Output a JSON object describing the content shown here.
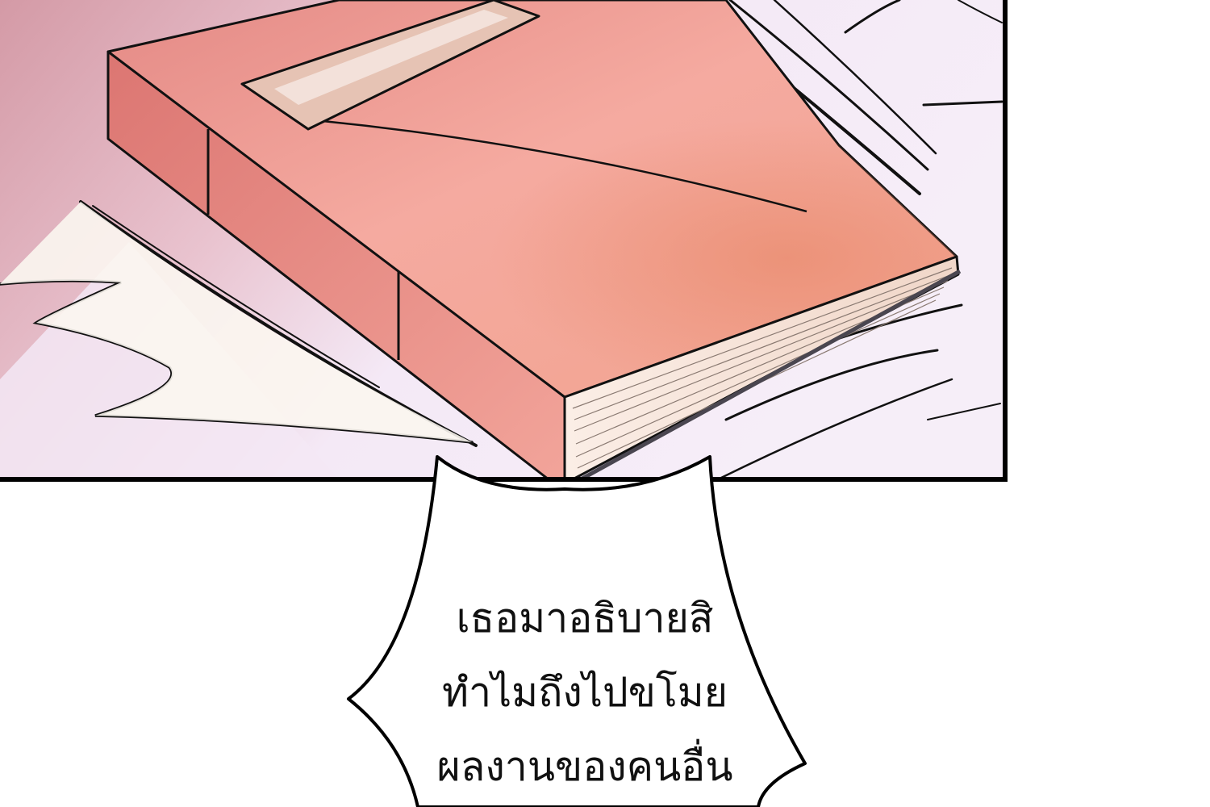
{
  "panel": {
    "background_color": "#f2e7f5",
    "shadow_color": "#d49aa6",
    "border_color": "#000000"
  },
  "book": {
    "cover_color": "#f2a79c",
    "spine_color": "#e3807b",
    "pages_color": "#fff6ee",
    "label_color": "#e8c4b4"
  },
  "speech_bubble": {
    "lines": [
      "เธอมาอธิบายสิ",
      "ทำไมถึงไปขโมย",
      "ผลงานของคนอื่น"
    ]
  }
}
